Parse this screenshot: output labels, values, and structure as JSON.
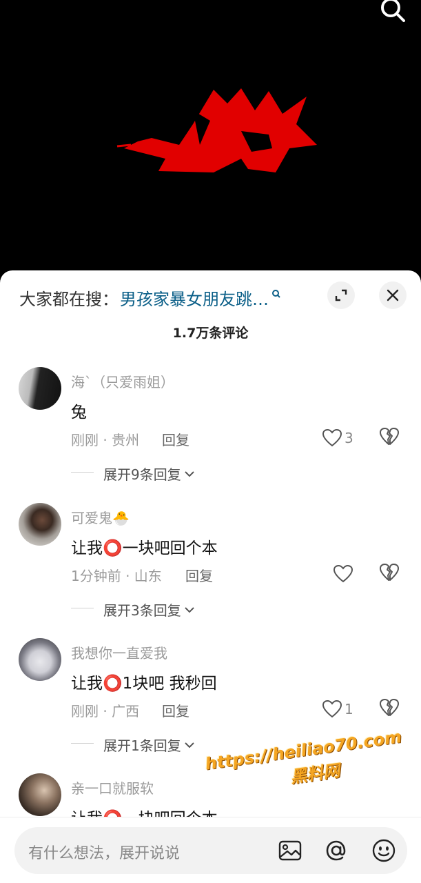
{
  "header": {
    "trending_prefix": "大家都在搜：",
    "trending_query": "男孩家暴女朋友跳…"
  },
  "comments_count": "1.7万条评论",
  "comments": [
    {
      "username": "海`（只爱雨姐）",
      "text": "兔",
      "time_location": "刚刚 · 贵州",
      "reply_label": "回复",
      "likes": "3",
      "expand_label": "展开9条回复"
    },
    {
      "username": "可爱鬼🐣",
      "text": "让我⭕一块吧回个本",
      "time_location": "1分钟前 · 山东",
      "reply_label": "回复",
      "likes": "",
      "expand_label": "展开3条回复"
    },
    {
      "username": "我想你一直爱我",
      "text": "让我⭕1块吧 我秒回",
      "time_location": "刚刚 · 广西",
      "reply_label": "回复",
      "likes": "1",
      "expand_label": "展开1条回复"
    },
    {
      "username": "亲一口就服软",
      "text": "让我⭕一块吧回个本"
    }
  ],
  "watermark": {
    "url": "https://heiliao70.com",
    "site": "黑料网"
  },
  "input": {
    "placeholder": "有什么想法，展开说说"
  },
  "icons": {
    "search": "search-icon",
    "expand": "expand-icon",
    "close": "close-icon",
    "like": "heart-icon",
    "dislike": "broken-heart-icon",
    "image": "image-icon",
    "at": "at-icon",
    "emoji": "emoji-icon"
  },
  "colors": {
    "trending_query": "#0b5f88",
    "watermark": "#f5a623",
    "video_highlight": "#ff0000"
  }
}
